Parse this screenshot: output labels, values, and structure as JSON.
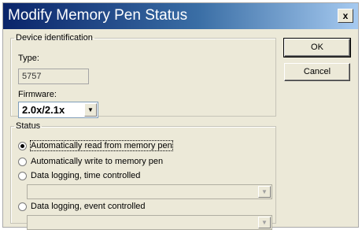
{
  "window": {
    "title": "Modify Memory Pen Status",
    "close_label": "x"
  },
  "device_identification": {
    "group_label": "Device identification",
    "type_label": "Type:",
    "type_value": "5757",
    "firmware_label": "Firmware:",
    "firmware_selected": "2.0x/2.1x"
  },
  "status": {
    "group_label": "Status",
    "options": [
      {
        "label": "Automatically read from memory pen",
        "selected": true
      },
      {
        "label": "Automatically write to memory pen",
        "selected": false
      },
      {
        "label": "Data logging, time controlled",
        "selected": false
      },
      {
        "label": "Data logging, event controlled",
        "selected": false
      }
    ]
  },
  "buttons": {
    "ok": "OK",
    "cancel": "Cancel"
  },
  "icons": {
    "dropdown": "chevron-down-icon"
  }
}
